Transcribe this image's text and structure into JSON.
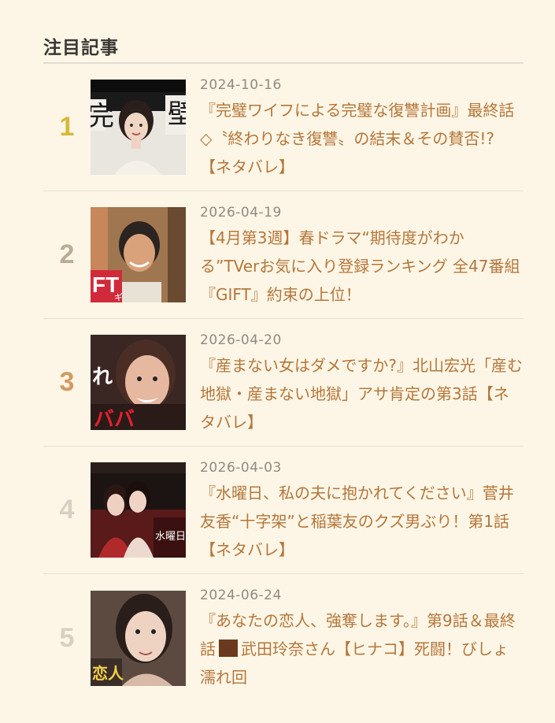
{
  "section": {
    "title": "注目記事"
  },
  "colors": {
    "rank_1": "#d6b93c",
    "rank_2": "#b9ac98",
    "rank_3": "#d49960",
    "rank_4": "#d6d0c4",
    "rank_5": "#d6d0c4",
    "title": "#b5763a",
    "date": "#8f8a82",
    "background": "#fdf6e6"
  },
  "articles": [
    {
      "rank": "1",
      "date": "2024-10-16",
      "title": "『完璧ワイフによる完璧な復讐計画』最終話◇〝終わりなき復讐〟の結末＆その賛否!?【ネタバレ】"
    },
    {
      "rank": "2",
      "date": "2026-04-19",
      "title": "【4月第3週】春ドラマ“期待度がわかる”TVerお気に入り登録ランキング 全47番組『GIFT』約束の上位！"
    },
    {
      "rank": "3",
      "date": "2026-04-20",
      "title": "『産まない女はダメですか?』北山宏光「産む地獄・産まない地獄」アサ肯定の第3話【ネタバレ】"
    },
    {
      "rank": "4",
      "date": "2026-04-03",
      "title": "『水曜日、私の夫に抱かれてください』菅井友香“十字架”と稲葉友のクズ男ぶり！第1話【ネタバレ】"
    },
    {
      "rank": "5",
      "date": "2024-06-24",
      "title_part1": "『あなたの恋人、強奪します。』第9話＆最終話",
      "title_part2": "武田玲奈さん【ヒナコ】死闘！びしょ濡れ回"
    }
  ],
  "thumbnails": {
    "thumb_2_text": "FT",
    "thumb_2_sub": "ギフト",
    "thumb_3_text_top": "れ",
    "thumb_3_text_bottom": "ババ",
    "thumb_4_text": "水曜日",
    "thumb_5_text": "恋人"
  }
}
